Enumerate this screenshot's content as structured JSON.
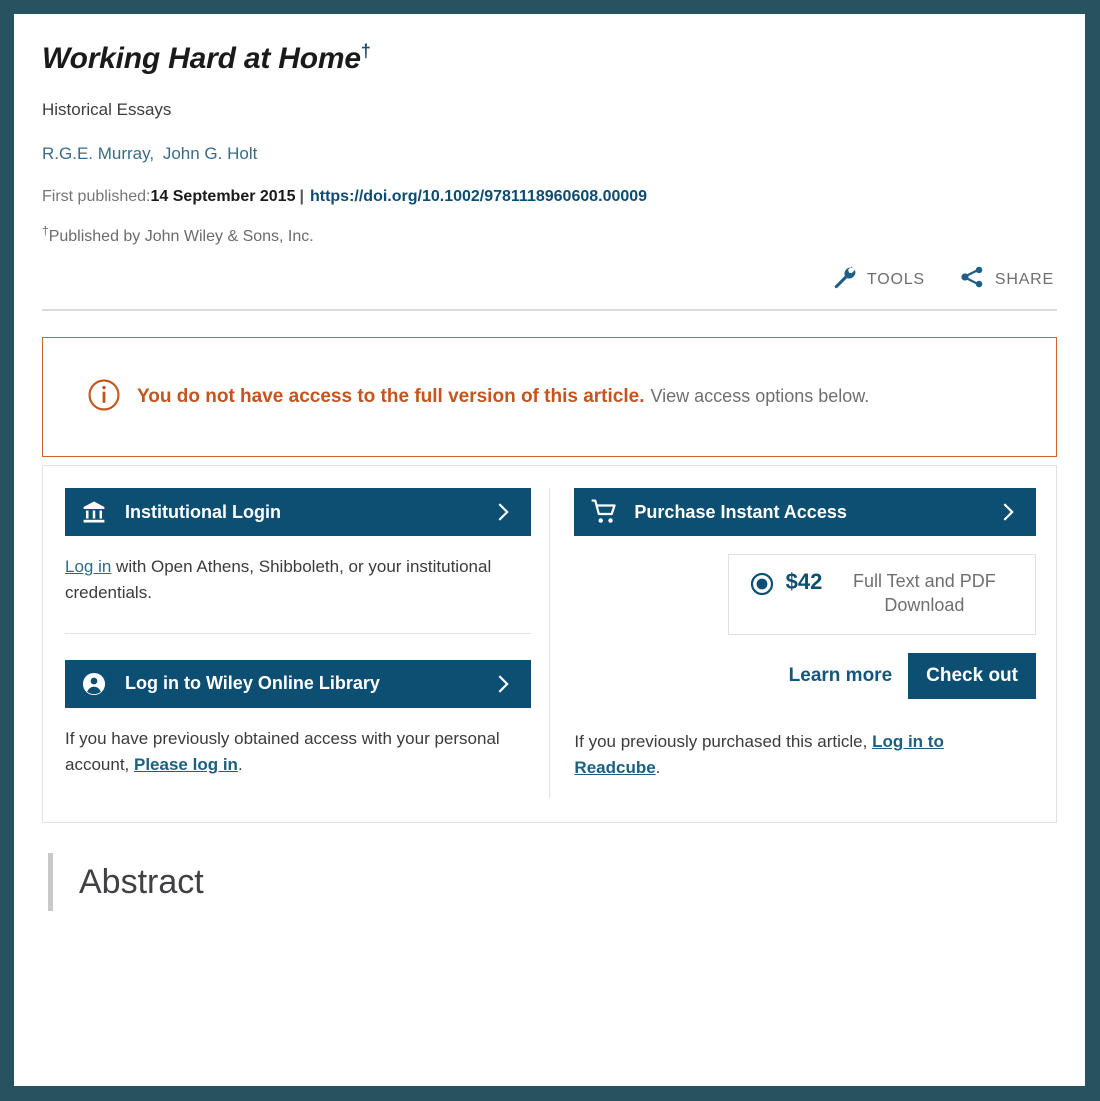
{
  "article": {
    "title": "Working Hard at Home",
    "title_footnote_mark": "†",
    "subtitle": "Historical Essays",
    "authors": [
      "R.G.E. Murray,",
      "John G. Holt"
    ],
    "first_published_label": "First published:",
    "first_published_date": "14 September 2015",
    "separator": "|",
    "doi": "https://doi.org/10.1002/9781118960608.00009",
    "footnote_mark": "†",
    "footnote_text": "Published by John Wiley & Sons, Inc."
  },
  "toolbar": {
    "tools_label": "TOOLS",
    "tools_icon": "wrench-icon",
    "share_label": "SHARE",
    "share_icon": "share-icon"
  },
  "alert": {
    "icon": "info-circle-icon",
    "strong_text": "You do not have access to the full version of this article.",
    "rest_text": "View access options below.",
    "border_color": "#d1622a",
    "strong_color": "#c4551f"
  },
  "access": {
    "institutional": {
      "bar_label": "Institutional Login",
      "bar_icon": "institution-icon",
      "chevron": "chevron-right-icon",
      "link_text": "Log in",
      "blurb_rest": " with Open Athens, Shibboleth, or your institutional credentials."
    },
    "wiley": {
      "bar_label": "Log in to Wiley Online Library",
      "bar_icon": "person-circle-icon",
      "chevron": "chevron-right-icon",
      "blurb_start": "If you have previously obtained access with your personal account, ",
      "link_text": "Please log in",
      "blurb_end": "."
    },
    "purchase": {
      "bar_label": "Purchase Instant Access",
      "bar_icon": "shopping-cart-icon",
      "chevron": "chevron-right-icon",
      "option_selected": true,
      "price": "$42",
      "price_description": "Full Text and PDF Download",
      "learn_more_label": "Learn more",
      "checkout_label": "Check out",
      "readcube_start": "If you previously purchased this article, ",
      "readcube_link": "Log in to Readcube",
      "readcube_end": "."
    }
  },
  "abstract": {
    "heading": "Abstract"
  },
  "colors": {
    "frame": "#27525f",
    "navy": "#0d4f73",
    "author_link": "#3b6c85",
    "muted": "#6f6f6f",
    "accent_orange": "#d1622a"
  }
}
